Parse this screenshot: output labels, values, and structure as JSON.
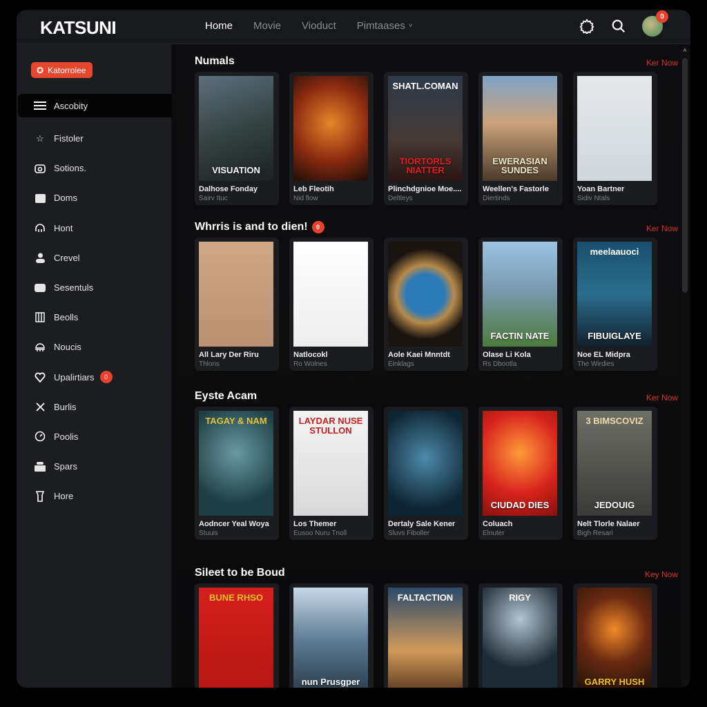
{
  "app": {
    "logo": "KATSUNI"
  },
  "nav": {
    "items": [
      {
        "label": "Home",
        "active": true
      },
      {
        "label": "Movie",
        "active": false
      },
      {
        "label": "Vioduct",
        "active": false
      },
      {
        "label": "Pimtaases",
        "active": false,
        "dropdown": true
      }
    ],
    "caret": "˅"
  },
  "topbar": {
    "icons": [
      "settings-icon",
      "search-icon"
    ],
    "notification_count": "0"
  },
  "sidebar": {
    "promo_label": "Katorrolee",
    "items": [
      {
        "label": "Ascobity",
        "icon": "menu-icon",
        "active": true
      },
      {
        "label": "Fistoler",
        "icon": "star-icon"
      },
      {
        "label": "Sotions.",
        "icon": "camera-icon"
      },
      {
        "label": "Doms",
        "icon": "folder-icon"
      },
      {
        "label": "Hont",
        "icon": "headphones-icon"
      },
      {
        "label": "Crevel",
        "icon": "user-icon"
      },
      {
        "label": "Sesentuls",
        "icon": "box-icon"
      },
      {
        "label": "Beolls",
        "icon": "library-icon"
      },
      {
        "label": "Noucis",
        "icon": "dome-icon"
      },
      {
        "label": "Upalirtiars",
        "icon": "heart-icon",
        "badge": "0"
      },
      {
        "label": "Burlis",
        "icon": "cross-icon"
      },
      {
        "label": "Poolis",
        "icon": "gauge-icon"
      },
      {
        "label": "Spars",
        "icon": "tray-icon"
      },
      {
        "label": "Hore",
        "icon": "cup-icon"
      }
    ]
  },
  "sections": [
    {
      "title": "Numals",
      "link": "Ker Now",
      "cards": [
        {
          "title": "Dalhose Fonday",
          "subtitle": "Sairv Ituc",
          "poster_text": "VISUATION",
          "poster_top": ""
        },
        {
          "title": "Leb Fleotih",
          "subtitle": "Nid flow",
          "poster_text": "",
          "poster_top": ""
        },
        {
          "title": "Plinchdgnioe Moe....",
          "subtitle": "Deltleys",
          "poster_text": "TIORTORLS NIATTER",
          "poster_top": "SHATL.COMAN"
        },
        {
          "title": "Weellen's Fastorle",
          "subtitle": "Diertinds",
          "poster_text": "EWERASIAN SUNDES",
          "poster_top": ""
        },
        {
          "title": "Yoan Bartner",
          "subtitle": "Sidiv Ntals",
          "poster_text": "",
          "poster_top": ""
        }
      ]
    },
    {
      "title": "Whrris is and to dien!",
      "badge": "0",
      "link": "Ker Now",
      "cards": [
        {
          "title": "All Lary Der Riru",
          "subtitle": "Thlons",
          "poster_text": "",
          "poster_top": ""
        },
        {
          "title": "Natlocokl",
          "subtitle": "Ro Wolnes",
          "poster_text": "",
          "poster_top": ""
        },
        {
          "title": "Aole Kaei Mnntdt",
          "subtitle": "Einklags",
          "poster_text": "",
          "poster_top": ""
        },
        {
          "title": "Olase Li Kola",
          "subtitle": "Rs Dbootla",
          "poster_text": "FACTIN NATE",
          "poster_top": ""
        },
        {
          "title": "Noe EL Midpra",
          "subtitle": "The Wirdies",
          "poster_text": "FIBUIGLAYE",
          "poster_top": "meelaauoci"
        }
      ]
    },
    {
      "title": "Eyste Acam",
      "link": "Ker Now",
      "cards": [
        {
          "title": "Aodncer Yeal Woya",
          "subtitle": "Stuuis",
          "poster_text": "",
          "poster_top": "TAGAY & NAM"
        },
        {
          "title": "Los Themer",
          "subtitle": "Eusoo Nuru Tnoll",
          "poster_text": "",
          "poster_top": "LAYDAR NUSE STULLON"
        },
        {
          "title": "Dertaly Sale Kener",
          "subtitle": "Sluvs Fiboller",
          "poster_text": "",
          "poster_top": ""
        },
        {
          "title": "Coluach",
          "subtitle": "Elnuter",
          "poster_text": "CIUDAD DIES",
          "poster_top": ""
        },
        {
          "title": "Nelt Tlorle Nalaer",
          "subtitle": "Bigh Resarl",
          "poster_text": "JEDOUIG",
          "poster_top": "3 BIMSCOVIZ"
        }
      ]
    },
    {
      "title": "Sileet to be Boud",
      "link": "Key Now",
      "cards": [
        {
          "title": "",
          "subtitle": "",
          "poster_text": "",
          "poster_top": "BUNE RHSO"
        },
        {
          "title": "",
          "subtitle": "",
          "poster_text": "nun Prusgper",
          "poster_top": ""
        },
        {
          "title": "",
          "subtitle": "",
          "poster_text": "",
          "poster_top": "FALTACTION"
        },
        {
          "title": "",
          "subtitle": "",
          "poster_text": "",
          "poster_top": "RIGY"
        },
        {
          "title": "",
          "subtitle": "",
          "poster_text": "GARRY HUSH",
          "poster_top": ""
        }
      ]
    }
  ],
  "colors": {
    "accent": "#e8472f",
    "link": "#d8332a",
    "background": "#0c0c0e",
    "sidebar": "#1c1d20"
  }
}
